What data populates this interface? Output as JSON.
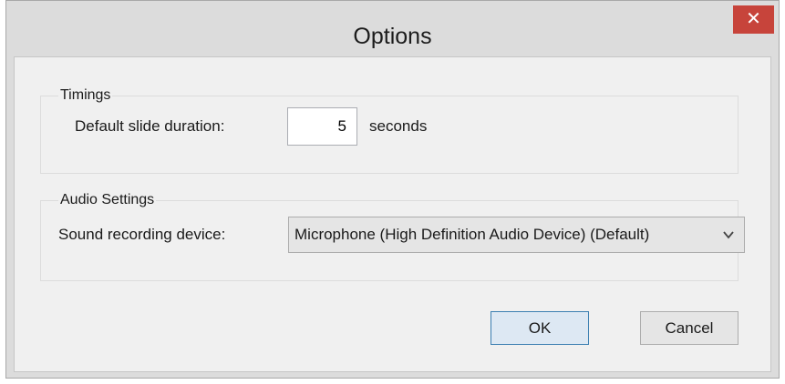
{
  "window": {
    "title": "Options",
    "close_glyph": "✕"
  },
  "timings": {
    "legend": "Timings",
    "duration_label": "Default slide duration:",
    "duration_value": "5",
    "unit_label": "seconds"
  },
  "audio": {
    "legend": "Audio Settings",
    "device_label": "Sound recording device:",
    "device_value": "Microphone (High Definition Audio Device) (Default)"
  },
  "buttons": {
    "ok": "OK",
    "cancel": "Cancel"
  },
  "colors": {
    "close_button": "#c7443b",
    "window_frame": "#dcdcdc",
    "client_bg": "#f0f0f0",
    "default_button_border": "#3c7fb1"
  },
  "icons": {
    "close": "close-icon",
    "dropdown": "chevron-down-icon"
  }
}
